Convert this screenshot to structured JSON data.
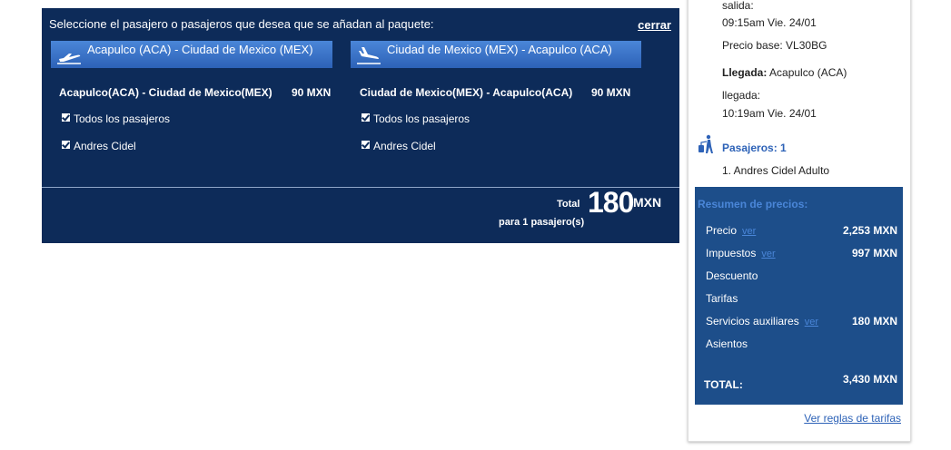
{
  "panel": {
    "heading": "Seleccione el pasajero o pasajeros que desea que se añadan al paquete:",
    "close_label": "cerrar",
    "segments": [
      {
        "tab_label": "Acapulco (ACA) - Ciudad de Mexico (MEX)",
        "title": "Acapulco(ACA) - Ciudad de Mexico(MEX)",
        "price": "90 MXN",
        "options": [
          "Todos los pasajeros",
          "Andres Cidel"
        ]
      },
      {
        "tab_label": "Ciudad de Mexico (MEX) - Acapulco (ACA)",
        "title": "Ciudad de Mexico(MEX) - Acapulco(ACA)",
        "price": "90 MXN",
        "options": [
          "Todos los pasajeros",
          "Andres Cidel"
        ]
      }
    ],
    "total_label": "Total",
    "total_amount": "180",
    "total_currency": "MXN",
    "total_sub": "para 1 pasajero(s)"
  },
  "side": {
    "salida_label": "salida:",
    "salida_time": "09:15am Vie. 24/01",
    "precio_base": "Precio base: VL30BG",
    "llegada_label": "Llegada:",
    "llegada_place": "Acapulco (ACA)",
    "llegada_label2": "llegada:",
    "llegada_time": "10:19am Vie. 24/01",
    "pasajeros_label": "Pasajeros: 1",
    "pasajero_1": "1. Andres Cidel Adulto",
    "summary": {
      "heading": "Resumen de precios:",
      "ver_label": "ver",
      "rows": [
        {
          "label": "Precio",
          "amount": "2,253 MXN"
        },
        {
          "label": "Impuestos",
          "amount": "997 MXN"
        },
        {
          "label": "Descuento",
          "amount": ""
        },
        {
          "label": "Tarifas",
          "amount": ""
        },
        {
          "label": "Servicios auxiliares",
          "amount": "180 MXN"
        },
        {
          "label": "Asientos",
          "amount": ""
        }
      ],
      "total_label": "TOTAL:",
      "total_amount": "3,430 MXN"
    },
    "rules_link": "Ver reglas de tarifas"
  }
}
